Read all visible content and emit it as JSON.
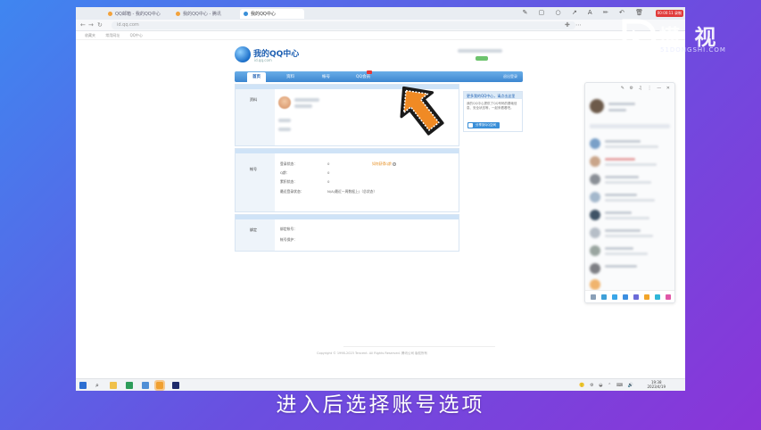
{
  "browser": {
    "tabs": [
      {
        "label": "QQ邮箱 - 我的QQ中心"
      },
      {
        "label": "我的QQ中心 - 腾讯"
      },
      {
        "label": "我的QQ中心"
      }
    ],
    "rec_badge": "00:00:11 录制",
    "url_text": "id.qq.com",
    "bookmarks": [
      "收藏夹",
      "常用网址",
      "QQ中心"
    ]
  },
  "qq_center": {
    "logo_title": "我的QQ中心",
    "logo_sub": "id.qq.com",
    "nav": [
      {
        "label": "首页",
        "active": true
      },
      {
        "label": "资料"
      },
      {
        "label": "帐号"
      },
      {
        "label": "QQ会员",
        "new": true
      }
    ],
    "nav_right": "退出登录",
    "profile_section": {
      "label": "资料"
    },
    "account_section": {
      "label": "帐号",
      "rows": [
        {
          "label": "登录状态：",
          "value": "0"
        },
        {
          "label": "Q龄：",
          "value": "0"
        },
        {
          "label": "累积状态：",
          "value": "0"
        },
        {
          "label": "最近登录状态：",
          "value": "N/A(最近一周数据上)（总状态）"
        }
      ],
      "link": "如何获得Q龄"
    },
    "bind_section": {
      "label": "绑定",
      "rows": [
        {
          "label": "绑定帐号："
        },
        {
          "label": "帐号保护："
        }
      ]
    },
    "notice": {
      "title": "更多我的QQ中心，请点击这里",
      "body": "我的QQ中心提供了QQ号码的基础信息、安全状态等，一起来看看吧。",
      "share_button": "分享到QQ空间"
    },
    "footer": "Copyright © 1998-2023 Tencent. All Rights Reserved.   腾讯公司 版权所有"
  },
  "taskbar": {
    "time": "19:38",
    "date": "2023/4/19"
  },
  "brand": {
    "name": "懂 视",
    "sub": "51DONGSHI.COM"
  },
  "caption": "进入后选择账号选项",
  "colors": {
    "accent": "#3c86d0",
    "arrow": "#f08a24",
    "background_start": "#3f86f0",
    "background_end": "#8a35d8"
  }
}
